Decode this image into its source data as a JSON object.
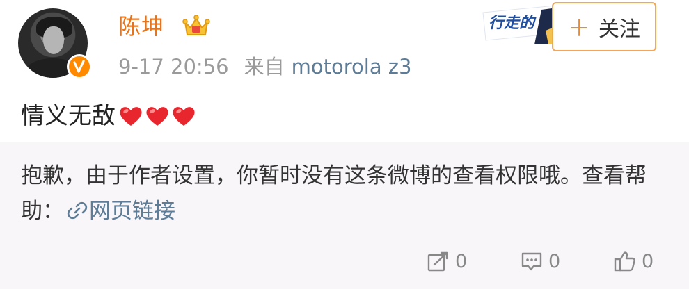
{
  "post": {
    "author": "陈坤",
    "time": "9-17 20:56",
    "source_prefix": "来自",
    "device": "motorola z3",
    "text": "情义无敌",
    "hearts_count": 3,
    "sticker_text": "行走的"
  },
  "follow": {
    "plus": "+",
    "label": "关注"
  },
  "notice": {
    "line": "抱歉，由于作者设置，你暂时没有这条微博的查看权限哦。查看帮助：",
    "link": "网页链接"
  },
  "actions": {
    "repost_count": "0",
    "comment_count": "0",
    "like_count": "0"
  },
  "colors": {
    "username": "#e8741a",
    "link": "#5d7c97",
    "follow_border": "#f3a55a",
    "badge": "#ff8a00"
  },
  "icons": {
    "verified": "v-verified-badge-icon",
    "crown": "crown-icon",
    "link": "link-icon",
    "repost": "repost-icon",
    "comment": "comment-icon",
    "like": "thumbs-up-icon",
    "heart": "heart-icon"
  }
}
